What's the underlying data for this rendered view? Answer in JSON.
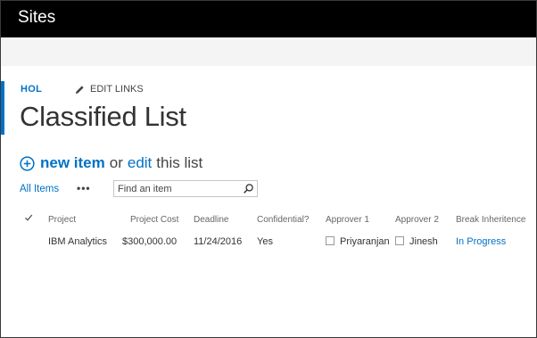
{
  "suitebar": {
    "title": "Sites"
  },
  "nav": {
    "home_link": "HOL",
    "edit_links": "EDIT LINKS"
  },
  "page": {
    "title": "Classified List"
  },
  "actions": {
    "new_item": "new item",
    "or": "or",
    "edit": "edit",
    "this_list": "this list"
  },
  "views": {
    "current": "All Items",
    "more": "•••"
  },
  "search": {
    "placeholder": "Find an item"
  },
  "table": {
    "headers": {
      "project": "Project",
      "cost": "Project Cost",
      "deadline": "Deadline",
      "confidential": "Confidential?",
      "approver1": "Approver 1",
      "approver2": "Approver 2",
      "break": "Break Inheritence"
    },
    "rows": [
      {
        "project": "IBM Analytics",
        "cost": "$300,000.00",
        "deadline": "11/24/2016",
        "confidential": "Yes",
        "approver1": "Priyaranjan",
        "approver2": "Jinesh",
        "break": "In Progress"
      }
    ]
  },
  "colors": {
    "accent": "#0072c6",
    "suitebar": "#000000"
  }
}
